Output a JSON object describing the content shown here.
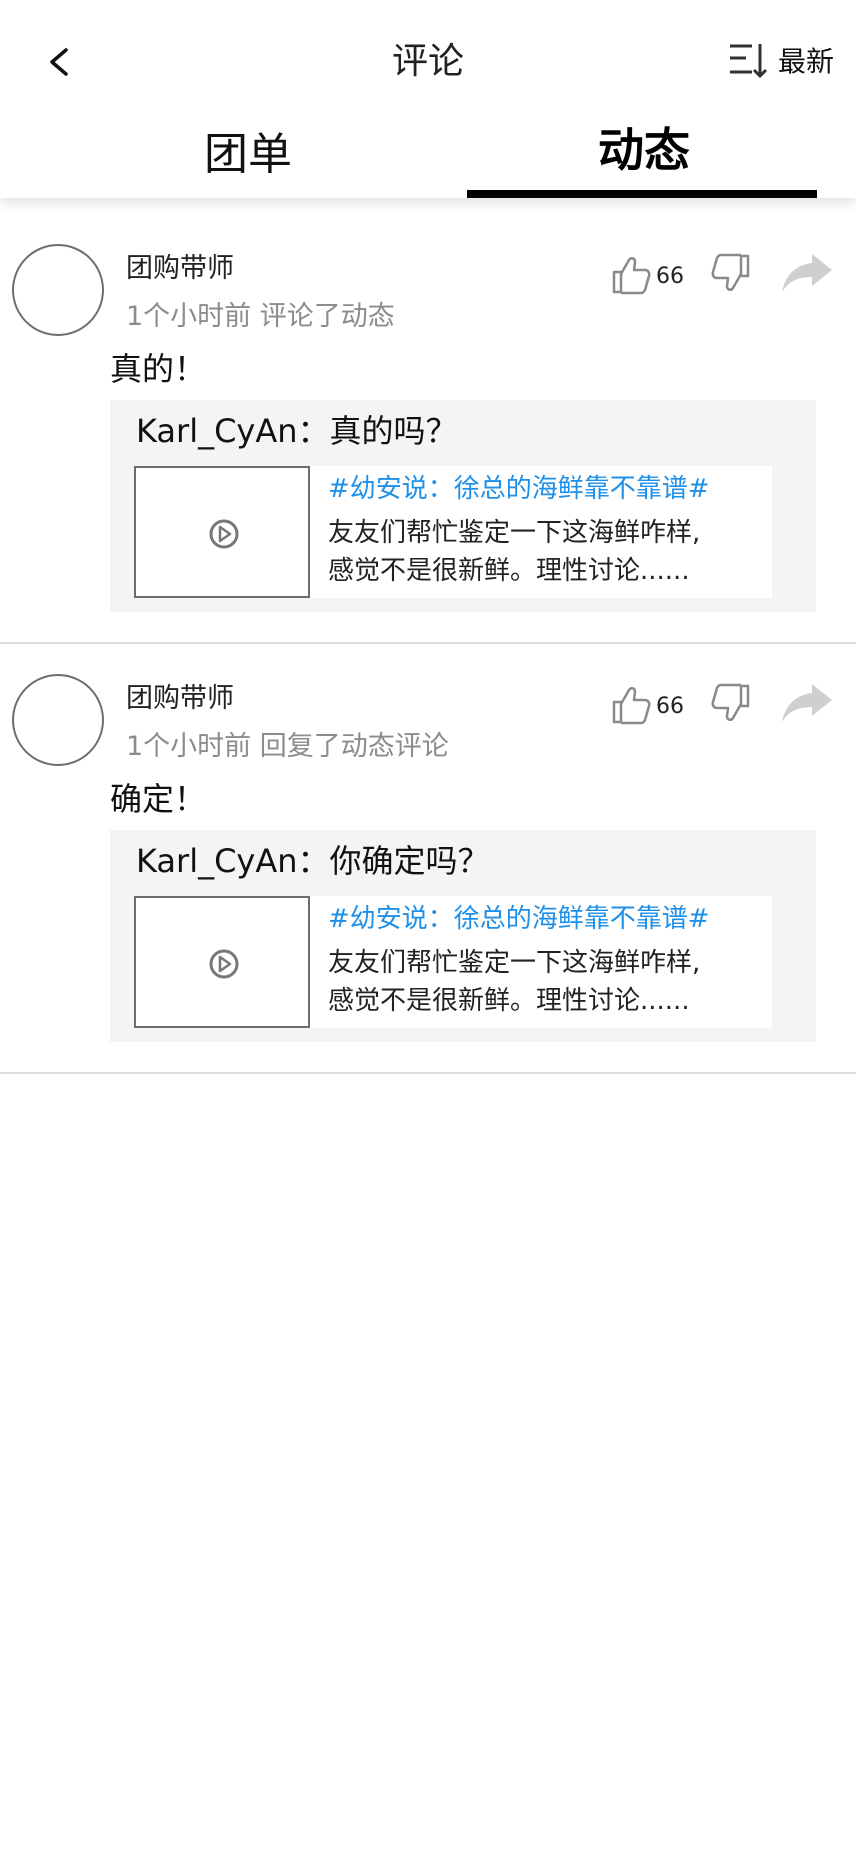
{
  "header": {
    "title": "评论",
    "sort_label": "最新",
    "tabs": [
      {
        "label": "团单",
        "active": false
      },
      {
        "label": "动态",
        "active": true
      }
    ]
  },
  "comments": [
    {
      "username": "团购带师",
      "meta": "1个小时前 评论了动态",
      "likes": "66",
      "text": "真的！",
      "quote": "Karl_CyAn：真的吗？",
      "topic": "#幼安说：徐总的海鲜靠不靠谱#",
      "desc_line1": "友友们帮忙鉴定一下这海鲜咋样,",
      "desc_line2": "感觉不是很新鲜。理性讨论......"
    },
    {
      "username": "团购带师",
      "meta": "1个小时前 回复了动态评论",
      "likes": "66",
      "text": "确定！",
      "quote": "Karl_CyAn：你确定吗？",
      "topic": "#幼安说：徐总的海鲜靠不靠谱#",
      "desc_line1": "友友们帮忙鉴定一下这海鲜咋样,",
      "desc_line2": "感觉不是很新鲜。理性讨论......"
    }
  ],
  "icons": {
    "back": "chevron-left-icon",
    "sort": "sort-icon",
    "like": "thumbs-up-icon",
    "dislike": "thumbs-down-icon",
    "share": "share-arrow-icon",
    "play": "play-icon"
  },
  "colors": {
    "topic_link": "#1e90e8",
    "meta_text": "#8c8c8c",
    "quote_bg": "#f4f4f4",
    "active_tab_underline": "#000000"
  }
}
